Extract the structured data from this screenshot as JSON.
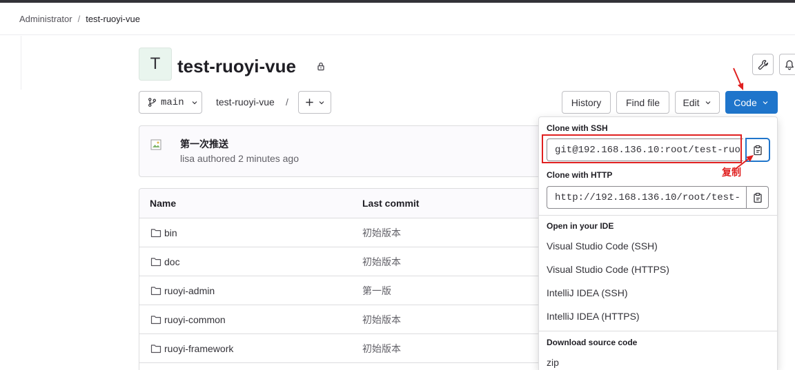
{
  "colors": {
    "accent": "#1f75cb",
    "annotation": "#e02020",
    "avatar_bg": "#e9f5ee"
  },
  "breadcrumb": {
    "group": "Administrator",
    "separator": "/",
    "project": "test-ruoyi-vue"
  },
  "project": {
    "avatar_letter": "T",
    "title": "test-ruoyi-vue",
    "visibility_icon": "lock-icon"
  },
  "header_actions": [
    {
      "icon": "wrench-icon"
    },
    {
      "icon": "bell-icon"
    }
  ],
  "toolbar": {
    "branch_icon": "branch-icon",
    "branch": "main",
    "path": "test-ruoyi-vue",
    "path_separator": "/",
    "add_icon": "plus-icon",
    "history": "History",
    "find_file": "Find file",
    "edit": "Edit",
    "code": "Code"
  },
  "last_commit": {
    "title": "第一次推送",
    "author": "lisa",
    "meta": "authored 2 minutes ago",
    "avatar_icon": "broken-image-icon"
  },
  "file_table": {
    "columns": [
      "Name",
      "Last commit"
    ],
    "rows": [
      {
        "icon": "folder-icon",
        "name": "bin",
        "commit": "初始版本"
      },
      {
        "icon": "folder-icon",
        "name": "doc",
        "commit": "初始版本"
      },
      {
        "icon": "folder-icon",
        "name": "ruoyi-admin",
        "commit": "第一版"
      },
      {
        "icon": "folder-icon",
        "name": "ruoyi-common",
        "commit": "初始版本"
      },
      {
        "icon": "folder-icon",
        "name": "ruoyi-framework",
        "commit": "初始版本"
      }
    ]
  },
  "code_dropdown": {
    "clone_ssh": {
      "label": "Clone with SSH",
      "value": "git@192.168.136.10:root/test-ruo",
      "copy_icon": "copy-icon"
    },
    "clone_http": {
      "label": "Clone with HTTP",
      "value": "http://192.168.136.10/root/test-",
      "copy_icon": "copy-icon"
    },
    "ide": {
      "label": "Open in your IDE",
      "items": [
        "Visual Studio Code (SSH)",
        "Visual Studio Code (HTTPS)",
        "IntelliJ IDEA (SSH)",
        "IntelliJ IDEA (HTTPS)"
      ]
    },
    "download": {
      "label": "Download source code",
      "items": [
        "zip"
      ]
    }
  },
  "annotations": {
    "copy_label": "复制"
  }
}
